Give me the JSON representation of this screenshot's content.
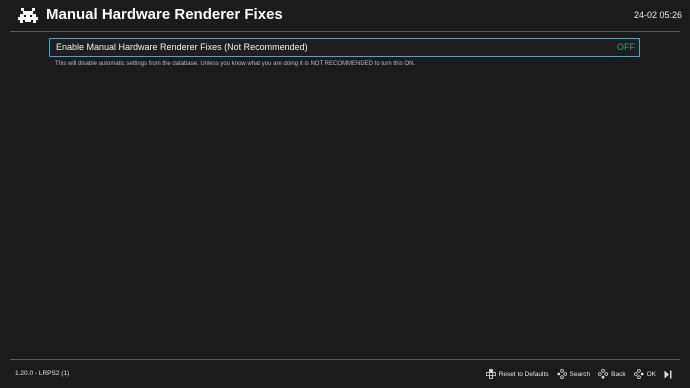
{
  "header": {
    "logo_icon": "retroarch-invader-icon",
    "title": "Manual Hardware Renderer Fixes",
    "clock": "24-02 05:26"
  },
  "setting": {
    "label": "Enable Manual Hardware Renderer Fixes (Not Recommended)",
    "value": "OFF",
    "description": "This will disable automatic settings from the database. Unless you know what you are doing it is NOT RECOMMENDED to turn this ON.",
    "selected": true
  },
  "footer": {
    "version": "1.20.0 - LRPS2 (1)",
    "actions": [
      {
        "icon": "dpad-vertical-icon",
        "label": "Reset to Defaults"
      },
      {
        "icon": "dpad-search-icon",
        "label": "Search"
      },
      {
        "icon": "dpad-back-icon",
        "label": "Back"
      },
      {
        "icon": "dpad-ok-icon",
        "label": "OK"
      },
      {
        "icon": "start-button-icon",
        "label": ""
      }
    ]
  },
  "colors": {
    "background": "#1b1b1b",
    "selection_border": "#2bb3d6",
    "value_off": "#2aa57b",
    "divider": "#5a5a5a"
  }
}
